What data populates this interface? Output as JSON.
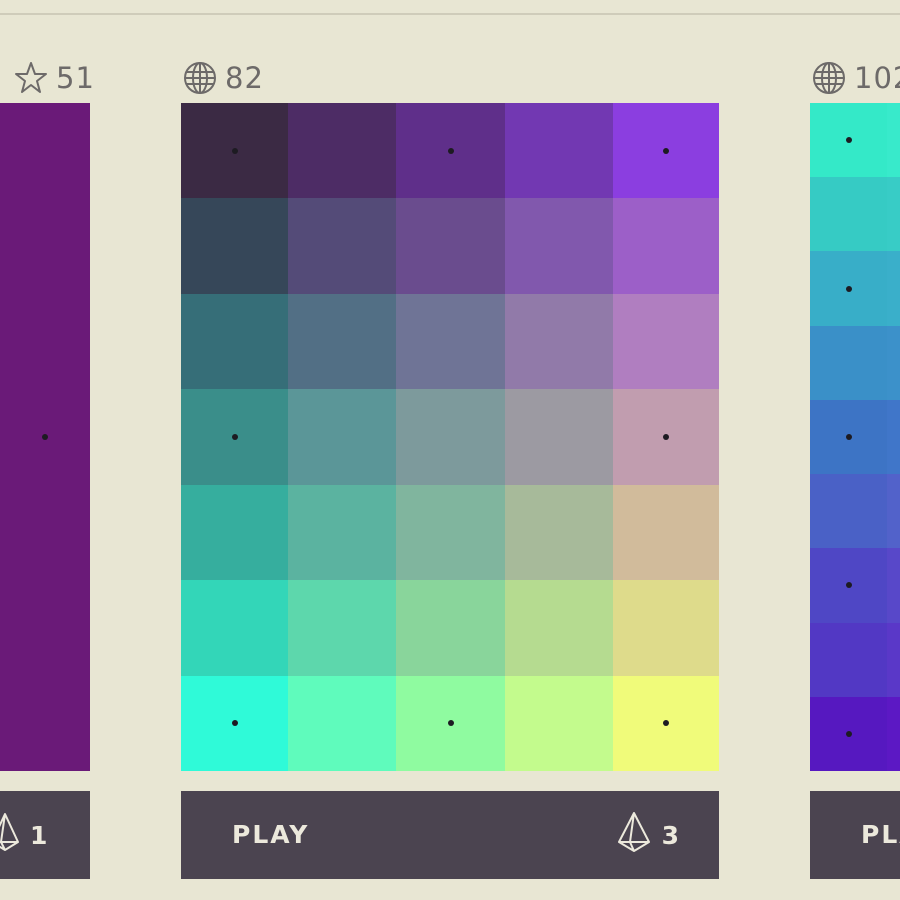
{
  "levels": [
    {
      "badge": {
        "icon": "star-icon",
        "value": "51"
      },
      "columns": 1,
      "cells": [
        [
          "#6a1a78",
          "#761b72",
          "#85196b",
          "#951864",
          "#a5165b",
          "#b81353",
          "#c81450",
          "#d41548"
        ]
      ],
      "dots": [
        [
          0,
          0
        ],
        [
          1,
          0
        ],
        [
          2,
          0
        ],
        [
          3,
          0
        ],
        [
          4,
          0
        ],
        [
          5,
          0
        ],
        [
          6,
          0
        ],
        [
          7,
          0
        ]
      ],
      "play": {
        "label": "PLAY",
        "moves_icon": "pyramid-icon",
        "moves": "1"
      }
    },
    {
      "badge": {
        "icon": "globe-icon",
        "value": "82"
      },
      "columns": 5,
      "cells": [
        [
          "#3b2a44",
          "#4d2c65",
          "#5f2f8a",
          "#7238b2",
          "#8b3ee0"
        ],
        [
          "#364759",
          "#544b78",
          "#6a4c8e",
          "#8158ad",
          "#9c5fc8"
        ],
        [
          "#366e78",
          "#526f85",
          "#6f7496",
          "#917aa9",
          "#b07ec0"
        ],
        [
          "#3a8e8a",
          "#5b9698",
          "#7d9a9c",
          "#9c9aa2",
          "#c19daf"
        ],
        [
          "#36ae9e",
          "#5bb3a0",
          "#80b59e",
          "#a7ba9a",
          "#d1bb9b"
        ],
        [
          "#33d6b8",
          "#5dd7ac",
          "#89d59b",
          "#b5db90",
          "#dedb8b"
        ],
        [
          "#2ffad8",
          "#5ffbbc",
          "#8ffba0",
          "#c3fb8d",
          "#f0fb7a"
        ]
      ],
      "dots": [
        [
          0,
          0
        ],
        [
          0,
          2
        ],
        [
          0,
          4
        ],
        [
          3,
          0
        ],
        [
          3,
          4
        ],
        [
          6,
          0
        ],
        [
          6,
          2
        ],
        [
          6,
          4
        ]
      ],
      "play": {
        "label": "PLAY",
        "moves_icon": "pyramid-icon",
        "moves": "3"
      }
    },
    {
      "badge": {
        "icon": "globe-icon",
        "value": "102"
      },
      "columns": 2,
      "cells": [
        [
          "#34e9c8",
          "#38eacb"
        ],
        [
          "#36cbc4",
          "#38ccc6"
        ],
        [
          "#38aec8",
          "#3aafca"
        ],
        [
          "#3a90c8",
          "#3c91ca"
        ],
        [
          "#3d74c5",
          "#4076c9"
        ],
        [
          "#4a61c6",
          "#5262ca"
        ],
        [
          "#4f47c5",
          "#5848c9"
        ],
        [
          "#5238c4",
          "#5a38c8"
        ],
        [
          "#5618c0",
          "#5c18c4"
        ]
      ],
      "dots": [
        [
          0,
          0
        ],
        [
          2,
          0
        ],
        [
          4,
          0
        ],
        [
          6,
          0
        ],
        [
          8,
          0
        ]
      ],
      "play": {
        "label": "PLAY",
        "moves_icon": "pyramid-icon",
        "moves": ""
      }
    }
  ]
}
